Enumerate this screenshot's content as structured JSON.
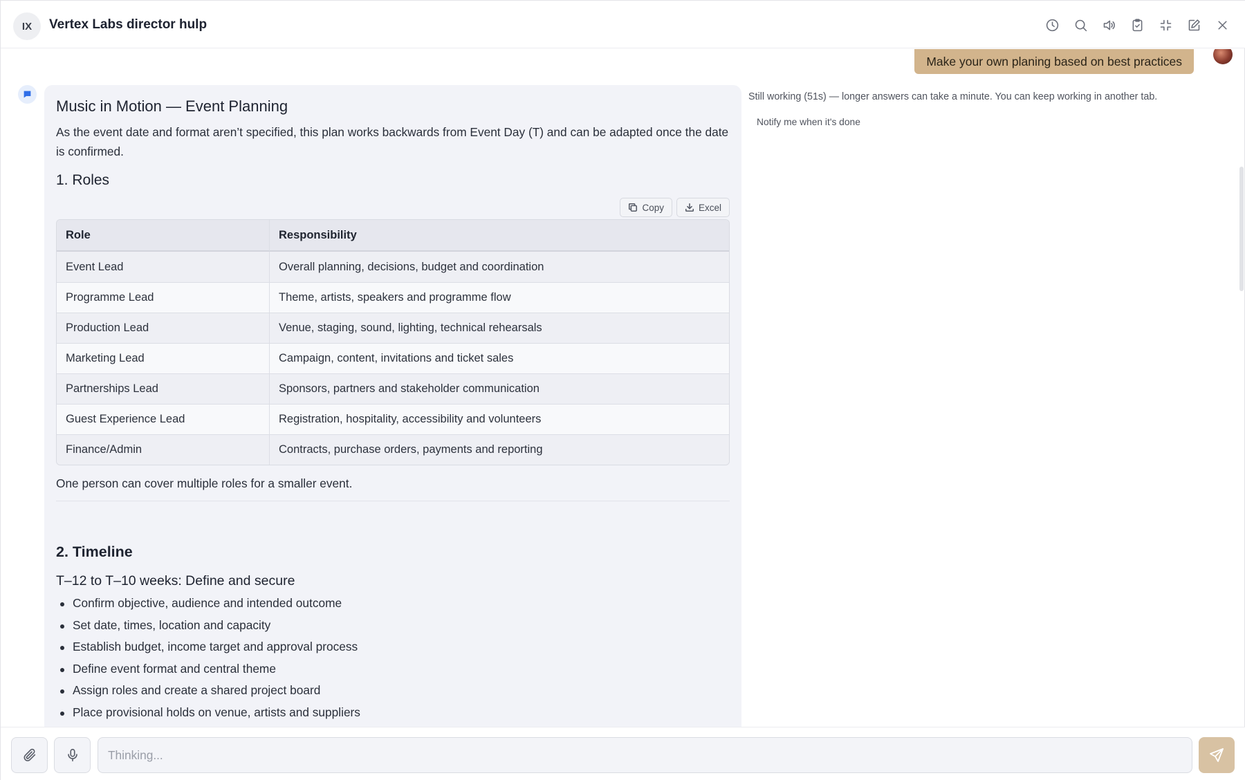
{
  "header": {
    "avatar_initials": "IX",
    "title": "Vertex Labs director hulp",
    "icons": [
      "history-icon",
      "search-icon",
      "speaker-icon",
      "clipboard-icon",
      "collapse-icon",
      "edit-icon",
      "close-icon"
    ]
  },
  "user_message": "Make your own planing based on best practices",
  "answer": {
    "title": "Music in Motion — Event Planning",
    "lead": "As the event date and format aren’t specified, this plan works backwards from Event Day (T) and can be adapted once the date is confirmed.",
    "roles_heading": "1. Roles",
    "copy_label": "Copy",
    "excel_label": "Excel",
    "table": {
      "headers": [
        "Role",
        "Responsibility"
      ],
      "rows": [
        [
          "Event Lead",
          "Overall planning, decisions, budget and coordination"
        ],
        [
          "Programme Lead",
          "Theme, artists, speakers and programme flow"
        ],
        [
          "Production Lead",
          "Venue, staging, sound, lighting, technical rehearsals"
        ],
        [
          "Marketing Lead",
          "Campaign, content, invitations and ticket sales"
        ],
        [
          "Partnerships Lead",
          "Sponsors, partners and stakeholder communication"
        ],
        [
          "Guest Experience Lead",
          "Registration, hospitality, accessibility and volunteers"
        ],
        [
          "Finance/Admin",
          "Contracts, purchase orders, payments and reporting"
        ]
      ]
    },
    "note": "One person can cover multiple roles for a smaller event.",
    "timeline_heading": "2. Timeline",
    "phase1_heading": "T–12 to T–10 weeks: Define and secure",
    "phase1_items": [
      "Confirm objective, audience and intended outcome",
      "Set date, times, location and capacity",
      "Establish budget, income target and approval process",
      "Define event format and central theme",
      "Assign roles and create a shared project board",
      "Place provisional holds on venue, artists and suppliers"
    ]
  },
  "status": {
    "text": "Still working (51s) — longer answers can take a minute. You can keep working in another tab.",
    "notify_label": "Notify me when it's done"
  },
  "composer": {
    "placeholder": "Thinking..."
  },
  "colors": {
    "user_bubble": "#d2b48c",
    "send_button": "#d8c2a3",
    "answer_bg": "#f2f3f8",
    "bot_accent": "#2f6ee8"
  }
}
